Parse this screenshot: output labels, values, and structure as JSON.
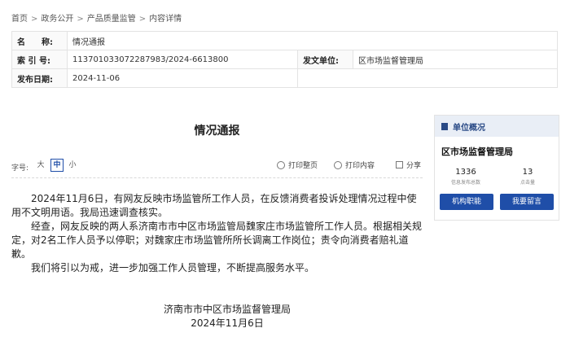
{
  "breadcrumb": [
    "首页",
    "政务公开",
    "产品质量监管",
    "内容详情"
  ],
  "meta": {
    "name_label": "名　　称:",
    "name_value": "情况通报",
    "index_label": "索 引 号:",
    "index_value": "113701033072287983/2024-6613800",
    "issuer_label": "发文单位:",
    "issuer_value": "区市场监督管理局",
    "date_label": "发布日期:",
    "date_value": "2024-11-06"
  },
  "article": {
    "title": "情况通报",
    "font_size_label": "字号:",
    "font_sizes": [
      "大",
      "中",
      "小"
    ],
    "active_font_size": "中",
    "print_page": "打印整页",
    "print_content": "打印内容",
    "share": "分享",
    "paragraphs": [
      "2024年11月6日，有网友反映市场监管所工作人员，在反馈消费者投诉处理情况过程中使用不文明用语。我局迅速调查核实。",
      "经查，网友反映的两人系济南市市中区市场监管局魏家庄市场监管所工作人员。根据相关规定，对2名工作人员予以停职；对魏家庄市场监管所所长调离工作岗位；责令向消费者赔礼道歉。",
      "我们将引以为戒，进一步加强工作人员管理，不断提高服务水平。"
    ],
    "sign_org": "济南市市中区市场监督管理局",
    "sign_date": "2024年11月6日"
  },
  "sidebar": {
    "header": "单位概况",
    "org": "区市场监督管理局",
    "stat1_value": "1336",
    "stat1_label": "信息发布总数",
    "stat2_value": "13",
    "stat2_label": "点击量",
    "btn1": "机构职能",
    "btn2": "我要留言"
  },
  "colors": {
    "accent": "#1f4ea8",
    "side_header_bg": "#e9eef6"
  }
}
